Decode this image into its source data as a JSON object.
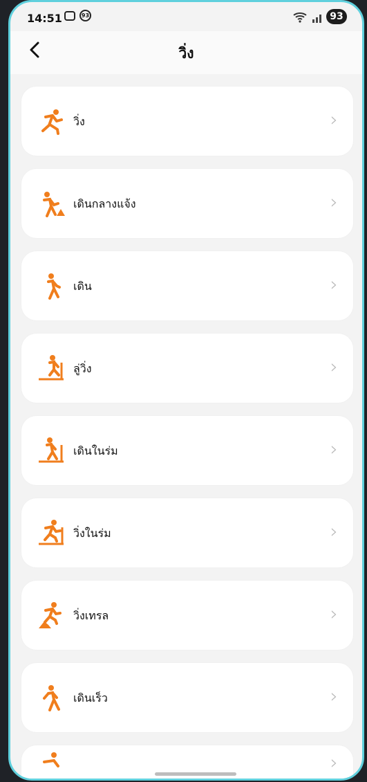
{
  "status": {
    "time": "14:51",
    "notif_icon": "screenshot-icon",
    "notif_badge": "93",
    "battery": "93"
  },
  "header": {
    "title": "วิ่ง",
    "back_icon": "chevron-left-icon"
  },
  "items": [
    {
      "label": "วิ่ง",
      "icon": "running-icon"
    },
    {
      "label": "เดินกลางแจ้ง",
      "icon": "outdoor-walk-icon"
    },
    {
      "label": "เดิน",
      "icon": "walking-icon"
    },
    {
      "label": "ลู่วิ่ง",
      "icon": "treadmill-icon"
    },
    {
      "label": "เดินในร่ม",
      "icon": "indoor-walk-icon"
    },
    {
      "label": "วิ่งในร่ม",
      "icon": "indoor-run-icon"
    },
    {
      "label": "วิ่งเทรล",
      "icon": "trail-run-icon"
    },
    {
      "label": "เดินเร็ว",
      "icon": "brisk-walk-icon"
    }
  ],
  "colors": {
    "accent": "#f07e1d"
  }
}
